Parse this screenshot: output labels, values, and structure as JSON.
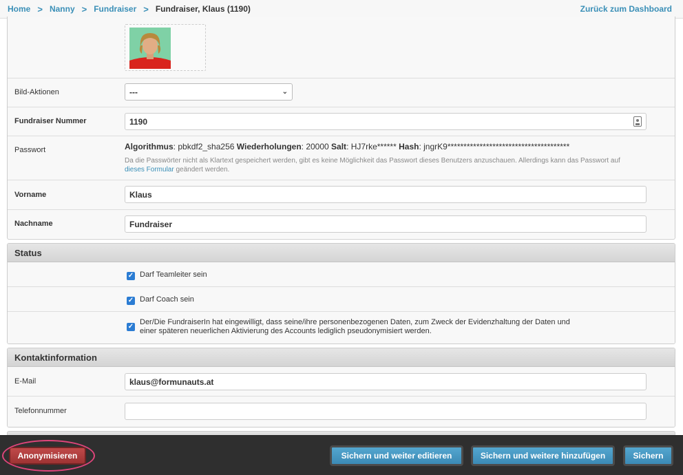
{
  "breadcrumb": {
    "items": [
      "Home",
      "Nanny",
      "Fundraiser"
    ],
    "current": "Fundraiser, Klaus (1190)",
    "separator": ">"
  },
  "back_link": "Zurück zum Dashboard",
  "general": {
    "bild_aktionen": {
      "label": "Bild-Aktionen",
      "value": "---"
    },
    "fundraiser_nummer": {
      "label": "Fundraiser Nummer",
      "value": "1190"
    },
    "passwort": {
      "label": "Passwort",
      "algo_label": "Algorithmus",
      "algo_value": "pbkdf2_sha256",
      "iter_label": "Wiederholungen",
      "iter_value": "20000",
      "salt_label": "Salt",
      "salt_value": "HJ7rke******",
      "hash_label": "Hash",
      "hash_value": "jngrK9**************************************",
      "help_text": "Da die Passwörter nicht als Klartext gespeichert werden, gibt es keine Möglichkeit das Passwort dieses Benutzers anzuschauen. Allerdings kann das Passwort auf",
      "help_link": "dieses Formular",
      "help_suffix": "geändert werden."
    },
    "vorname": {
      "label": "Vorname",
      "value": "Klaus"
    },
    "nachname": {
      "label": "Nachname",
      "value": "Fundraiser"
    }
  },
  "status": {
    "title": "Status",
    "checkboxes": [
      {
        "label": "Darf Teamleiter sein",
        "checked": true
      },
      {
        "label": "Darf Coach sein",
        "checked": true
      },
      {
        "label_line1": "Der/Die FundraiserIn hat eingewilligt, dass seine/ihre personenbezogenen Daten, zum Zweck der Evidenzhaltung der Daten und",
        "label_line2": "einer späteren neuerlichen Aktivierung des Accounts lediglich pseudonymisiert werden.",
        "checked": true
      }
    ]
  },
  "kontakt": {
    "title": "Kontaktinformation",
    "email": {
      "label": "E-Mail",
      "value": "klaus@formunauts.at"
    },
    "telefon": {
      "label": "Telefonnummer",
      "value": ""
    }
  },
  "footer": {
    "anonymize": "Anonymisieren",
    "save_continue": "Sichern und weiter editieren",
    "save_add": "Sichern und weitere hinzufügen",
    "save": "Sichern"
  },
  "colors": {
    "link": "#3a8fb7",
    "primary_button": "#3c8ab5",
    "danger_button": "#a83a3a",
    "highlight_circle": "#e0457b",
    "checkbox": "#2b7cd3"
  }
}
